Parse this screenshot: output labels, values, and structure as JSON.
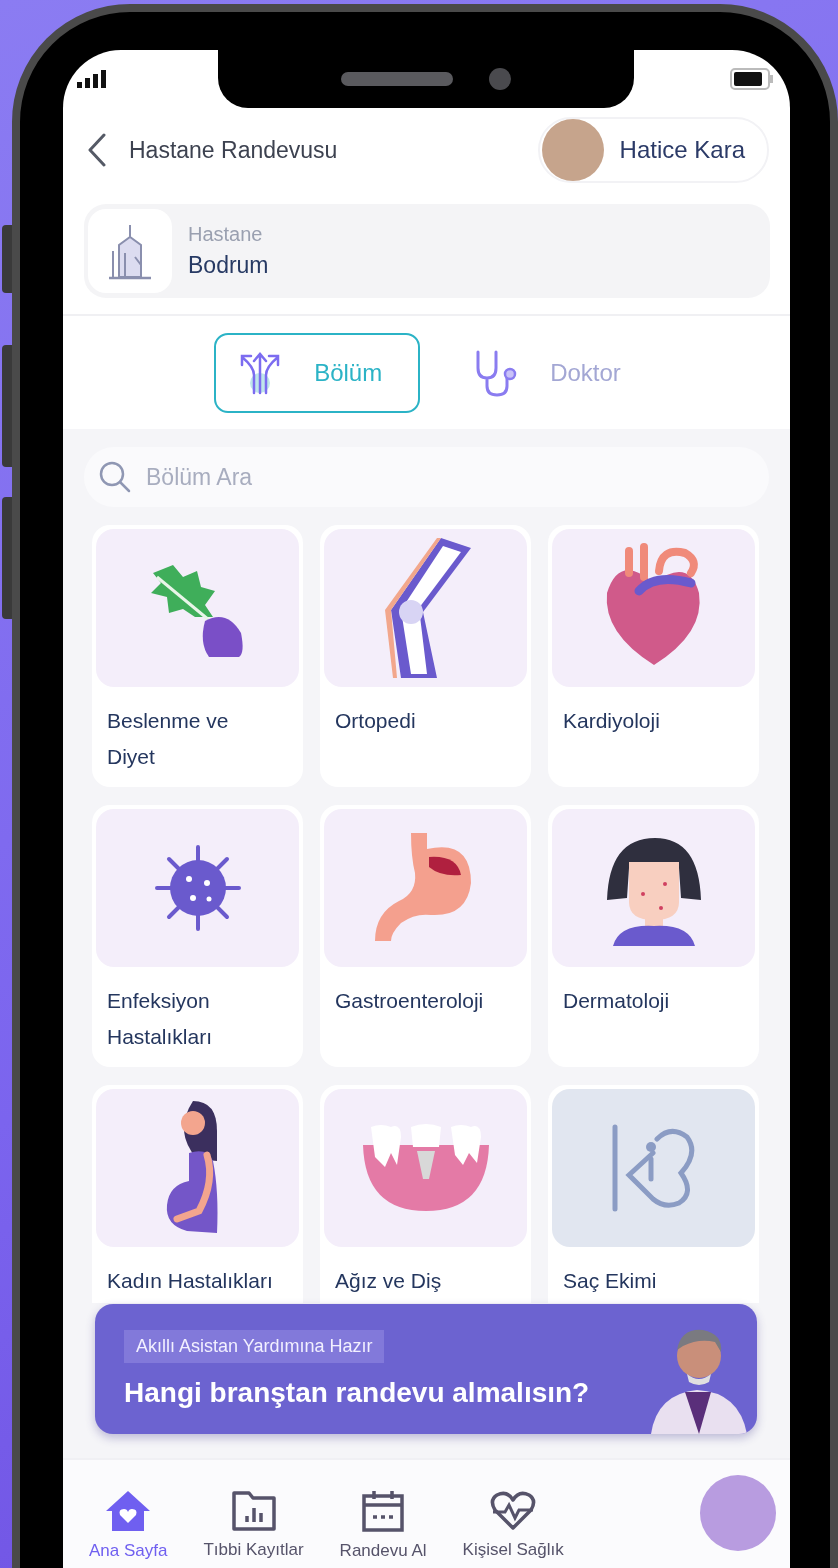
{
  "header": {
    "title": "Hastane Randevusu",
    "user_name": "Hatice Kara"
  },
  "hospital": {
    "label": "Hastane",
    "value": "Bodrum"
  },
  "tabs": [
    {
      "label": "Bölüm",
      "selected": true
    },
    {
      "label": "Doktor",
      "selected": false
    }
  ],
  "search": {
    "placeholder": "Bölüm Ara"
  },
  "departments": [
    {
      "label": "Beslenme ve Diyet"
    },
    {
      "label": "Ortopedi"
    },
    {
      "label": "Kardiyoloji"
    },
    {
      "label": "Enfeksiyon Hastalıkları"
    },
    {
      "label": "Gastroenteroloji"
    },
    {
      "label": "Dermatoloji"
    },
    {
      "label": "Kadın Hastalıkları"
    },
    {
      "label": "Ağız ve Diş"
    },
    {
      "label": "Saç Ekimi"
    }
  ],
  "assistant_banner": {
    "tag": "Akıllı Asistan Yardımına Hazır",
    "headline": "Hangi branştan randevu almalısın?"
  },
  "bottom_nav": [
    {
      "label": "Ana Sayfa",
      "selected": true
    },
    {
      "label": "Tıbbi Kayıtlar",
      "selected": false
    },
    {
      "label": "Randevu Al",
      "selected": false
    },
    {
      "label": "Kişisel Sağlık",
      "selected": false
    }
  ]
}
